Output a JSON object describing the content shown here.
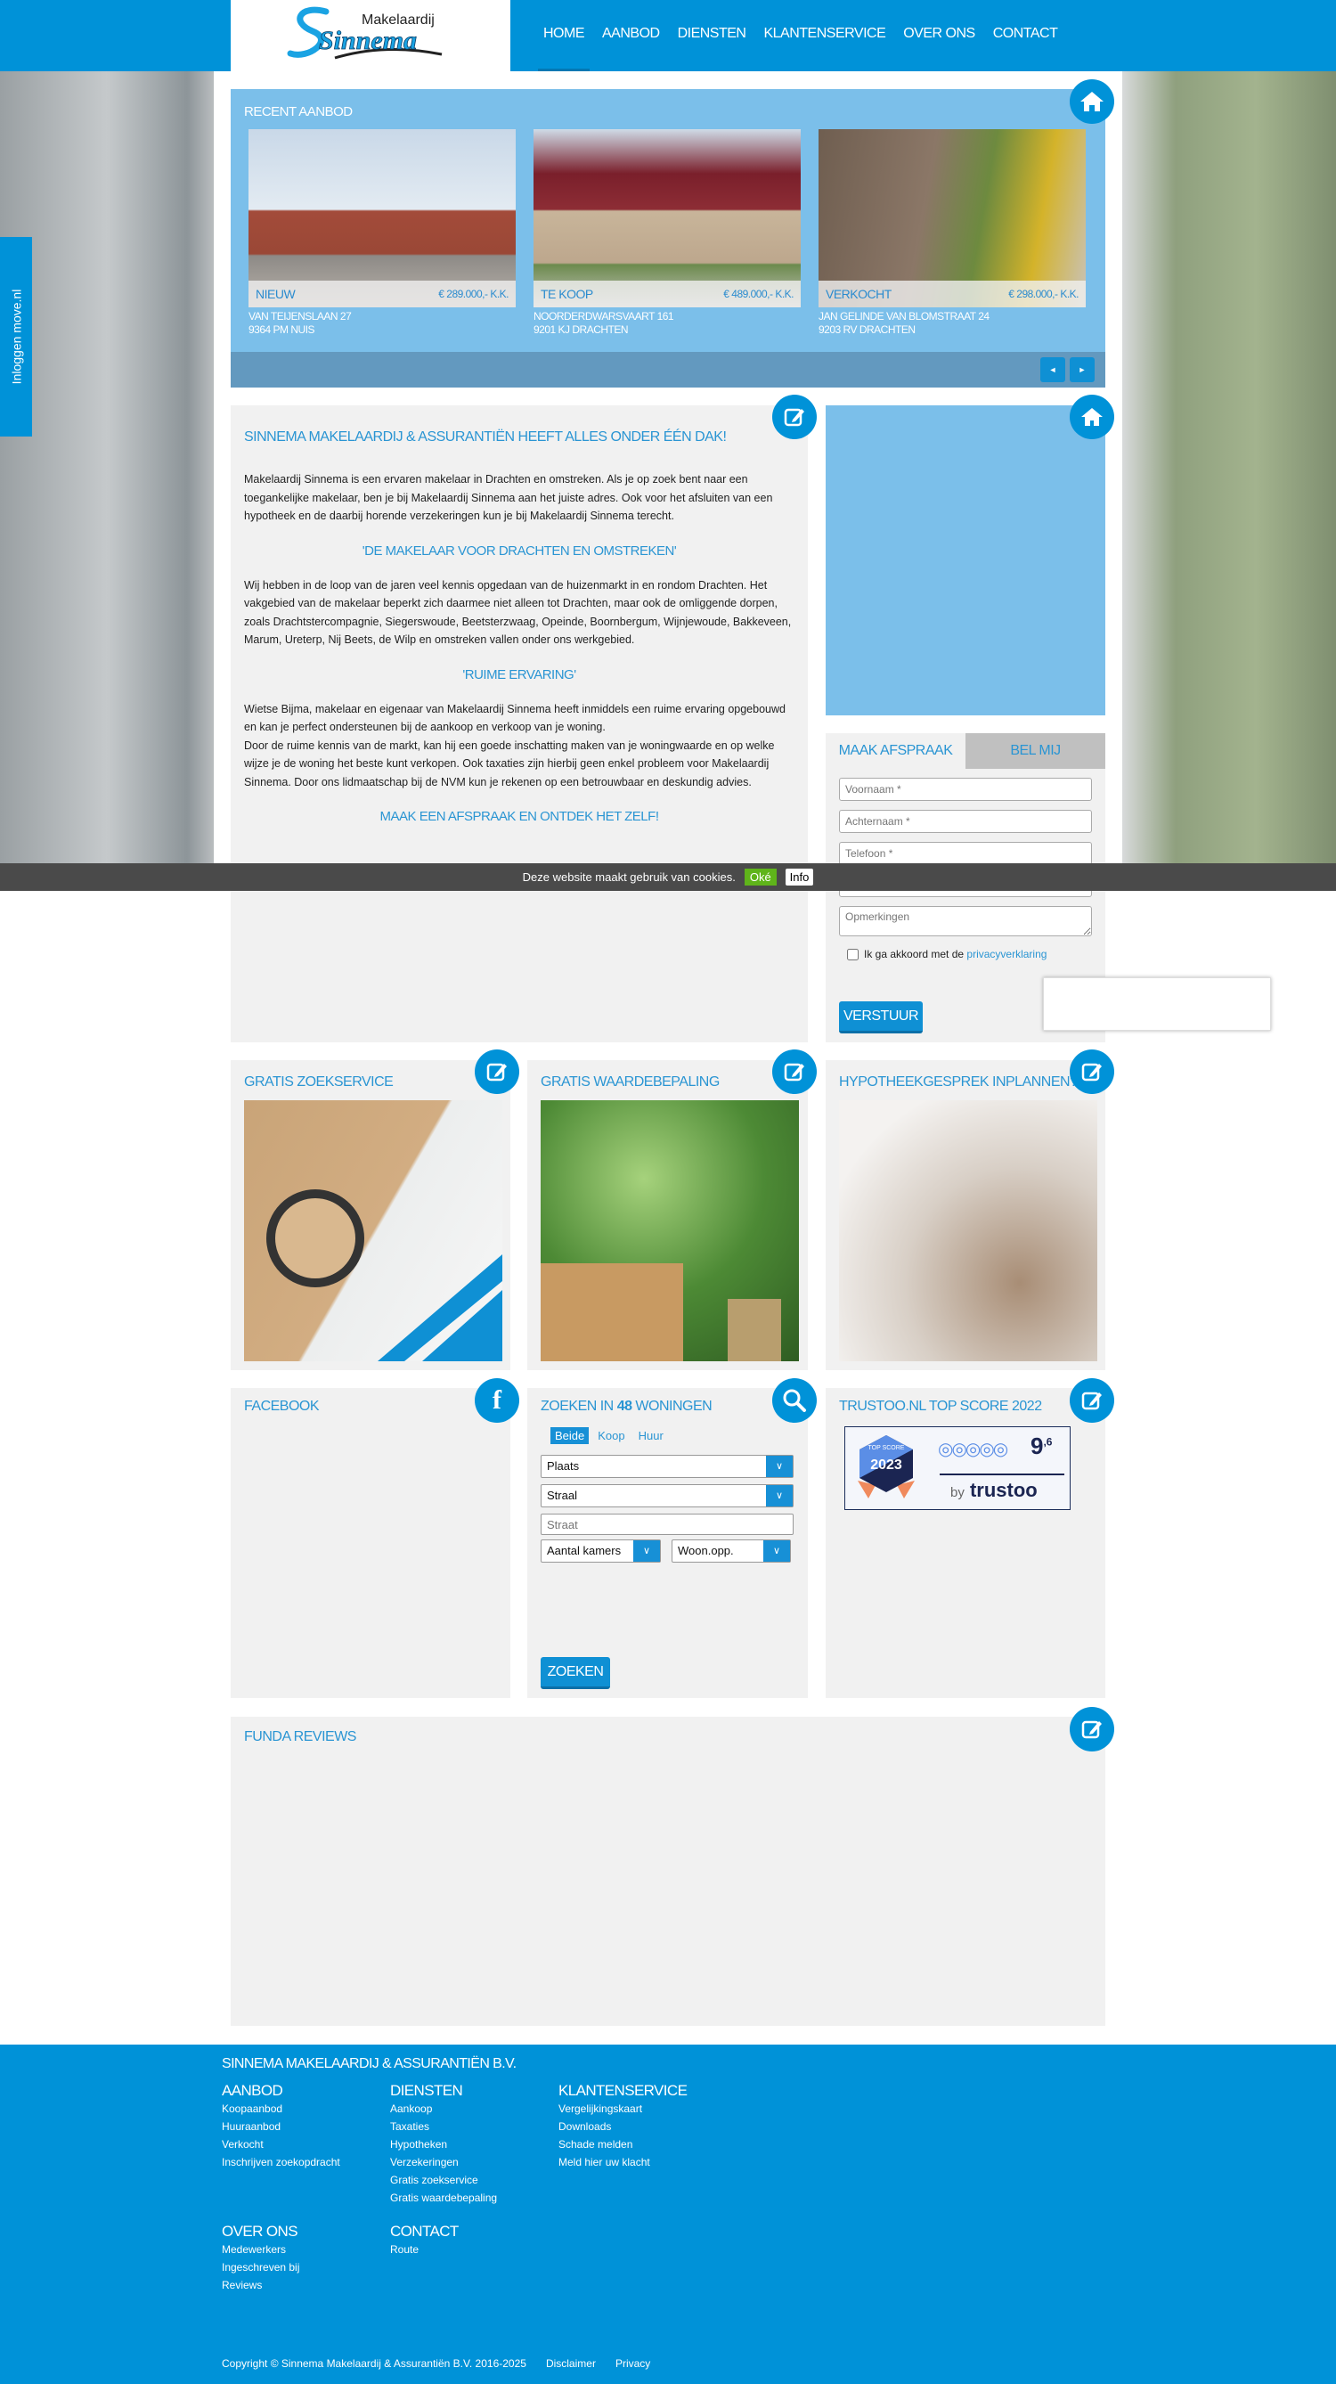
{
  "colors": {
    "brand": "#0092d8",
    "light_blue": "#7bbfea",
    "box_bg": "#f1f1f1",
    "cookie_bar": "#4a4a4a",
    "ok_green": "#5fb41a"
  },
  "logo": {
    "small": "Makelaardij",
    "big": "Sinnema"
  },
  "nav": [
    {
      "label": "HOME",
      "active": true
    },
    {
      "label": "AANBOD"
    },
    {
      "label": "DIENSTEN"
    },
    {
      "label": "KLANTENSERVICE"
    },
    {
      "label": "OVER ONS"
    },
    {
      "label": "CONTACT"
    }
  ],
  "side_tab": "Inloggen move.nl",
  "recent": {
    "title": "RECENT AANBOD",
    "icon": "house-icon",
    "listings": [
      {
        "status": "NIEUW",
        "price": "€ 289.000,- K.K.",
        "street": "VAN TEIJENSLAAN 27",
        "city": "9364 PM NUIS"
      },
      {
        "status": "TE KOOP",
        "price": "€ 489.000,- K.K.",
        "street": "NOORDERDWARSVAART 161",
        "city": "9201 KJ DRACHTEN"
      },
      {
        "status": "VERKOCHT",
        "price": "€ 298.000,- K.K.",
        "street": "JAN GELINDE VAN BLOMSTRAAT 24",
        "city": "9203 RV DRACHTEN"
      }
    ],
    "prev": "◄",
    "next": "►"
  },
  "intro": {
    "title": "SINNEMA MAKELAARDIJ & ASSURANTIËN HEEFT ALLES ONDER ÉÉN DAK!",
    "p1": "Makelaardij Sinnema is een ervaren makelaar in Drachten en omstreken. Als je op zoek bent naar een toegankelijke makelaar, ben je bij Makelaardij Sinnema aan het juiste adres. Ook voor het afsluiten van een hypotheek en de daarbij horende verzekeringen kun je bij Makelaardij Sinnema terecht.",
    "h1": "'DE MAKELAAR VOOR DRACHTEN EN OMSTREKEN'",
    "p2": "Wij hebben in de loop van de jaren veel kennis opgedaan van de huizenmarkt in en rondom Drachten. Het vakgebied van de makelaar beperkt zich daarmee niet alleen tot Drachten, maar ook de omliggende dorpen, zoals Drachtstercompagnie, Siegerswoude, Beetsterzwaag, Opeinde, Boornbergum, Wijnjewoude, Bakkeveen, Marum, Ureterp, Nij Beets, de Wilp en omstreken vallen onder ons werkgebied.",
    "h2": "'RUIME ERVARING'",
    "p3a": "Wietse Bijma, makelaar en eigenaar van Makelaardij Sinnema heeft inmiddels een ruime ervaring opgebouwd en kan je perfect ondersteunen bij de aankoop en verkoop van je woning.",
    "p3b": "Door de ruime kennis van de markt, kan hij een goede inschatting maken van je woningwaarde en op welke wijze je de woning het beste kunt verkopen. Ook taxaties zijn hierbij geen enkel probleem voor Makelaardij Sinnema. Door ons lidmaatschap bij de NVM kun je rekenen op een betrouwbaar en deskundig advies.",
    "h3": "MAAK EEN AFSPRAAK EN ONTDEK HET ZELF!"
  },
  "form": {
    "tabs": [
      "MAAK AFSPRAAK",
      "BEL MIJ"
    ],
    "voornaam": "Voornaam *",
    "achternaam": "Achternaam *",
    "telefoon": "Telefoon *",
    "opmerkingen": "Opmerkingen",
    "agree": "Ik ga akkoord met de ",
    "privacy": "privacyverklaring",
    "submit": "VERSTUUR"
  },
  "cookie": {
    "text": "Deze website maakt gebruik van cookies.",
    "ok": "Oké",
    "info": "Info"
  },
  "promos": [
    {
      "title": "GRATIS ZOEKSERVICE"
    },
    {
      "title": "GRATIS WAARDEBEPALING"
    },
    {
      "title": "HYPOTHEEKGESPREK INPLANNEN?"
    }
  ],
  "facebook": {
    "title": "FACEBOOK"
  },
  "search": {
    "title_pre": "ZOEKEN IN ",
    "count": "48",
    "title_post": " WONINGEN",
    "types": [
      "Beide",
      "Koop",
      "Huur"
    ],
    "plaats": "Plaats",
    "straat_sel": "Straal",
    "straat_ph": "Straat",
    "kamers": "Aantal kamers",
    "opp": "Woon.opp.",
    "submit": "ZOEKEN"
  },
  "trustoo": {
    "title": "TRUSTOO.NL TOP SCORE 2022",
    "badge_top": "TOP SCORE",
    "badge_year": "2023",
    "score": "9",
    "score_dec": ",6",
    "by": "by",
    "brand": "trustoo"
  },
  "funda": {
    "title": "FUNDA REVIEWS"
  },
  "footer": {
    "company": "SINNEMA MAKELAARDIJ & ASSURANTIËN B.V.",
    "cols": [
      {
        "h": "AANBOD",
        "links": [
          "Koopaanbod",
          "Huuraanbod",
          "Verkocht",
          "Inschrijven zoekopdracht"
        ]
      },
      {
        "h": "DIENSTEN",
        "links": [
          "Aankoop",
          "Taxaties",
          "Hypotheken",
          "Verzekeringen",
          "Gratis zoekservice",
          "Gratis waardebepaling"
        ]
      },
      {
        "h": "KLANTENSERVICE",
        "links": [
          "Vergelijkingskaart",
          "Downloads",
          "Schade melden",
          "Meld hier uw klacht"
        ]
      },
      {
        "h": "OVER ONS",
        "links": [
          "Medewerkers",
          "Ingeschreven bij",
          "Reviews"
        ]
      },
      {
        "h": "CONTACT",
        "links": [
          "Route"
        ]
      }
    ],
    "copyright": "Copyright © Sinnema Makelaardij & Assurantiën B.V. 2016-2025",
    "disclaimer": "Disclaimer",
    "privacy": "Privacy"
  }
}
